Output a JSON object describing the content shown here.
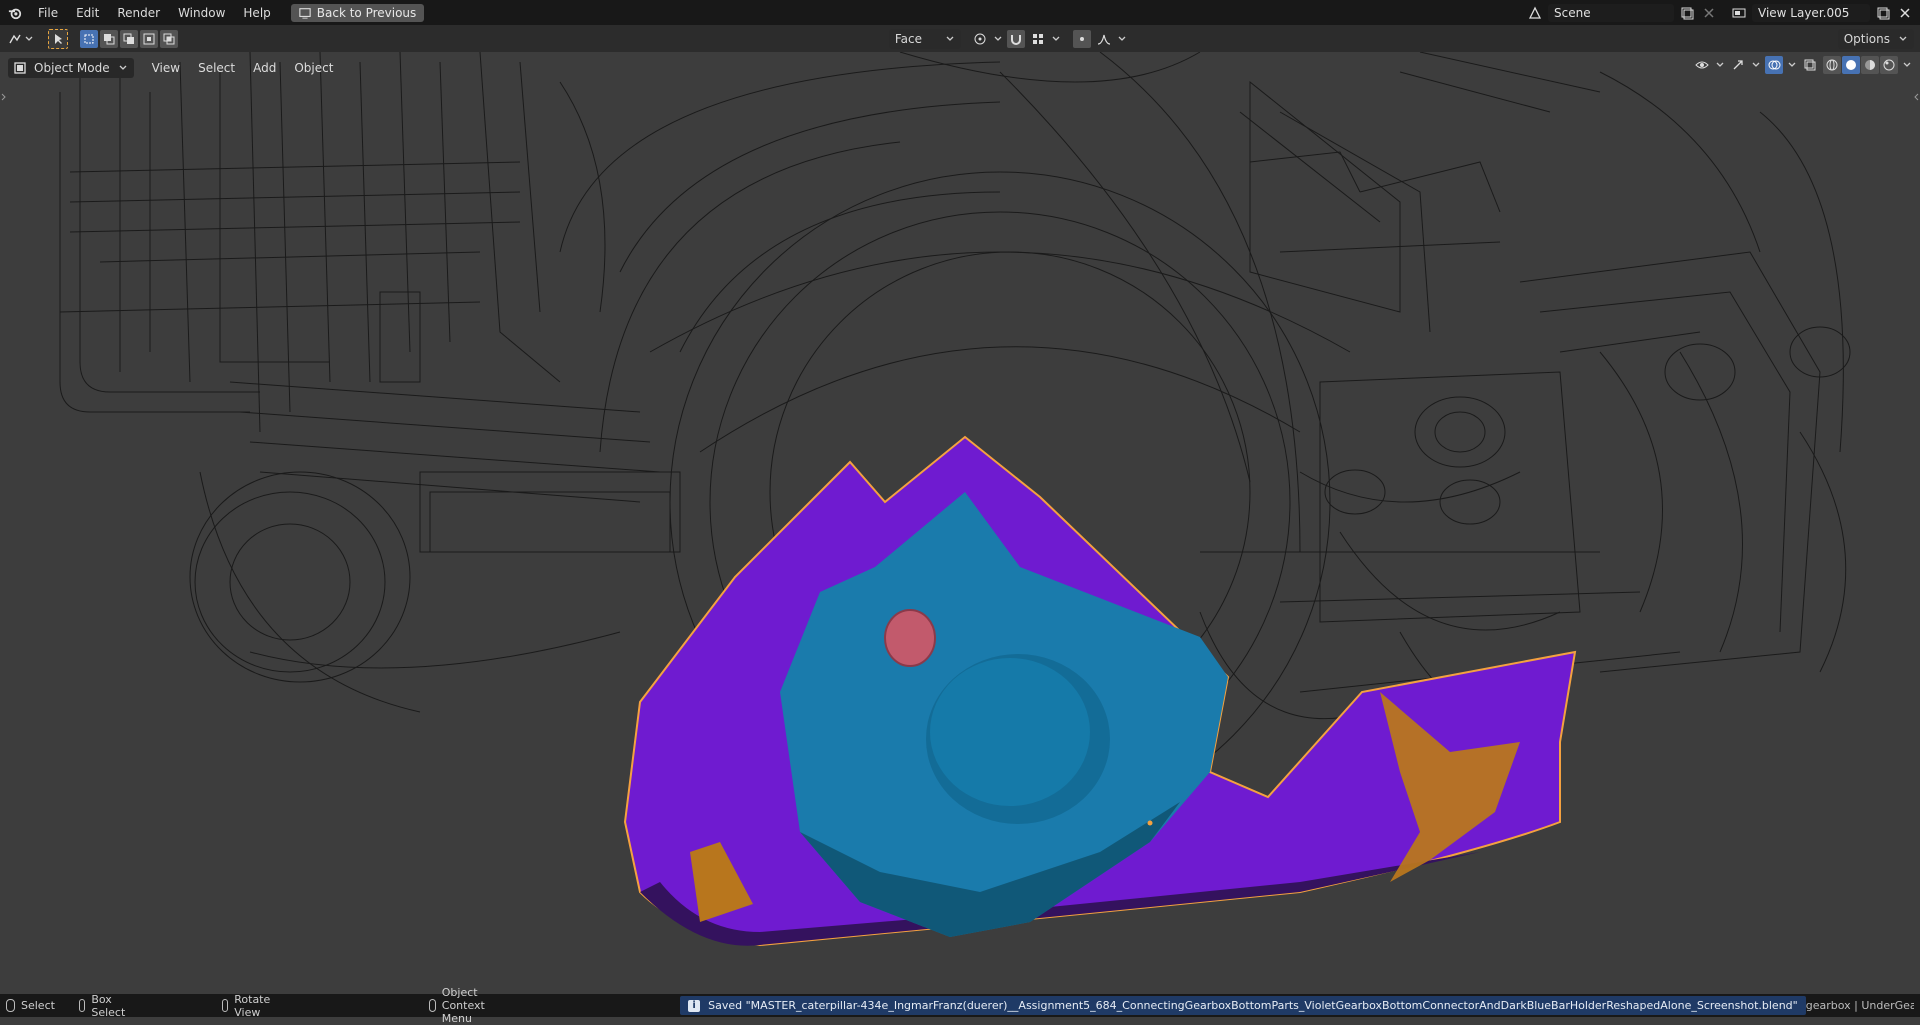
{
  "topbar": {
    "menus": [
      "File",
      "Edit",
      "Render",
      "Window",
      "Help"
    ],
    "back_label": "Back to Previous",
    "scene_value": "Scene",
    "view_layer_value": "View Layer.005"
  },
  "toolbar": {
    "orientation_value": "Face",
    "options_label": "Options"
  },
  "viewport": {
    "mode_label": "Object Mode",
    "menus": [
      "View",
      "Select",
      "Add",
      "Object"
    ]
  },
  "statusbar": {
    "select_label": "Select",
    "box_select_label": "Box Select",
    "rotate_view_label": "Rotate View",
    "context_menu_label": "Object Context Menu",
    "saved_message": "Saved \"MASTER_caterpillar-434e_IngmarFranz(duerer)__Assignment5_684_ConnectingGearboxBottomParts_VioletGearboxBottomConnectorAndDarkBlueBarHolderReshapedAlone_Screenshot.blend\"",
    "scene_info": "gearbox | UnderGearboxToFro"
  },
  "colors": {
    "accent": "#4772b3",
    "selection_outline": "#f4a140",
    "violet_part": "#6f1bd0",
    "blue_part": "#1a7bac",
    "orange_part": "#b8761d",
    "pink_hole": "#c25a6c"
  }
}
